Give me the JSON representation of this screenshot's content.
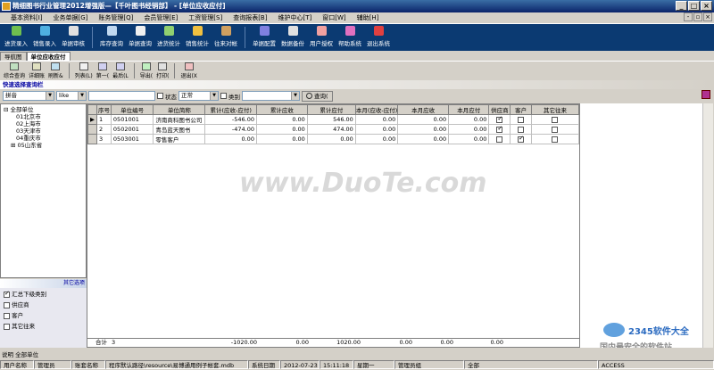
{
  "window": {
    "title": "精细图书行业管理2012增强版—【千叶图书经销部】 - [单位应收应付]"
  },
  "menu": [
    "基本资料[I]",
    "业务单据[G]",
    "账务管理[Q]",
    "会员管理[E]",
    "工资管理[S]",
    "查询报表[B]",
    "维护中心[T]",
    "窗口[W]",
    "辅助[H]"
  ],
  "toolbar": [
    "进货录入",
    "销售录入",
    "单据审核",
    "库存查询",
    "单据查询",
    "进货统计",
    "销售统计",
    "往来对帐",
    "单据配置",
    "数据备份",
    "用户授权",
    "帮助系统",
    "退出系统"
  ],
  "tabs": [
    "导航图",
    "单位应收应付"
  ],
  "subtoolbar": [
    "综合查询",
    "详细账",
    "刷新&",
    "列表(L)",
    "第一(",
    "最后(L",
    "导出(",
    "打印(",
    "退出(X"
  ],
  "quick_label": "快速选择查询栏",
  "search": {
    "field": "拼音",
    "op": "like",
    "status_label": "状态",
    "status_value": "正常",
    "category_label": "类别",
    "query_btn": "查询("
  },
  "tree": [
    "全部单位",
    "01北京市",
    "02上海市",
    "03天津市",
    "04重庆市",
    "05山东省"
  ],
  "other_options": {
    "title": "其它选项",
    "items": [
      {
        "label": "汇总下级类别",
        "checked": true
      },
      {
        "label": "供应商",
        "checked": false
      },
      {
        "label": "客户",
        "checked": false
      },
      {
        "label": "其它往来",
        "checked": false
      }
    ]
  },
  "grid": {
    "headers": [
      "序号",
      "单位编号",
      "单位简称",
      "累计(应收-应付)",
      "累计应收",
      "累计应付",
      "本月(应收-应付)",
      "本月应收",
      "本月应付",
      "供应商",
      "客户",
      "其它往来"
    ],
    "rows": [
      {
        "no": "1",
        "code": "0501001",
        "name": "济南商科图书公司",
        "net": "-546.00",
        "recv": "0.00",
        "pay": "546.00",
        "m_net": "0.00",
        "m_recv": "0.00",
        "m_pay": "0.00",
        "supplier": true,
        "customer": false,
        "other": false
      },
      {
        "no": "2",
        "code": "0502001",
        "name": "青岛蓝天图书",
        "net": "-474.00",
        "recv": "0.00",
        "pay": "474.00",
        "m_net": "0.00",
        "m_recv": "0.00",
        "m_pay": "0.00",
        "supplier": true,
        "customer": false,
        "other": false
      },
      {
        "no": "3",
        "code": "0503001",
        "name": "零售客户",
        "net": "0.00",
        "recv": "0.00",
        "pay": "0.00",
        "m_net": "0.00",
        "m_recv": "0.00",
        "m_pay": "0.00",
        "supplier": false,
        "customer": true,
        "other": false
      }
    ],
    "totals": {
      "label": "合计",
      "count": "3",
      "net": "-1020.00",
      "recv": "0.00",
      "pay": "1020.00",
      "m_net": "0.00",
      "m_recv": "0.00",
      "m_pay": "0.00"
    }
  },
  "watermark": "www.DuoTe.com",
  "brand": {
    "text": "2345软件大全",
    "slogan": "国内最安全的软件站"
  },
  "desc": "说明  全部单位",
  "status": [
    "用户名称",
    "管理员",
    "账套名称",
    "程序默认路径\\resource\\易博通用例子帐套.mdb",
    "系统日期",
    "2012-07-23",
    "15:11:18",
    "星期一",
    "管理员组",
    "全部",
    "ACCESS"
  ]
}
